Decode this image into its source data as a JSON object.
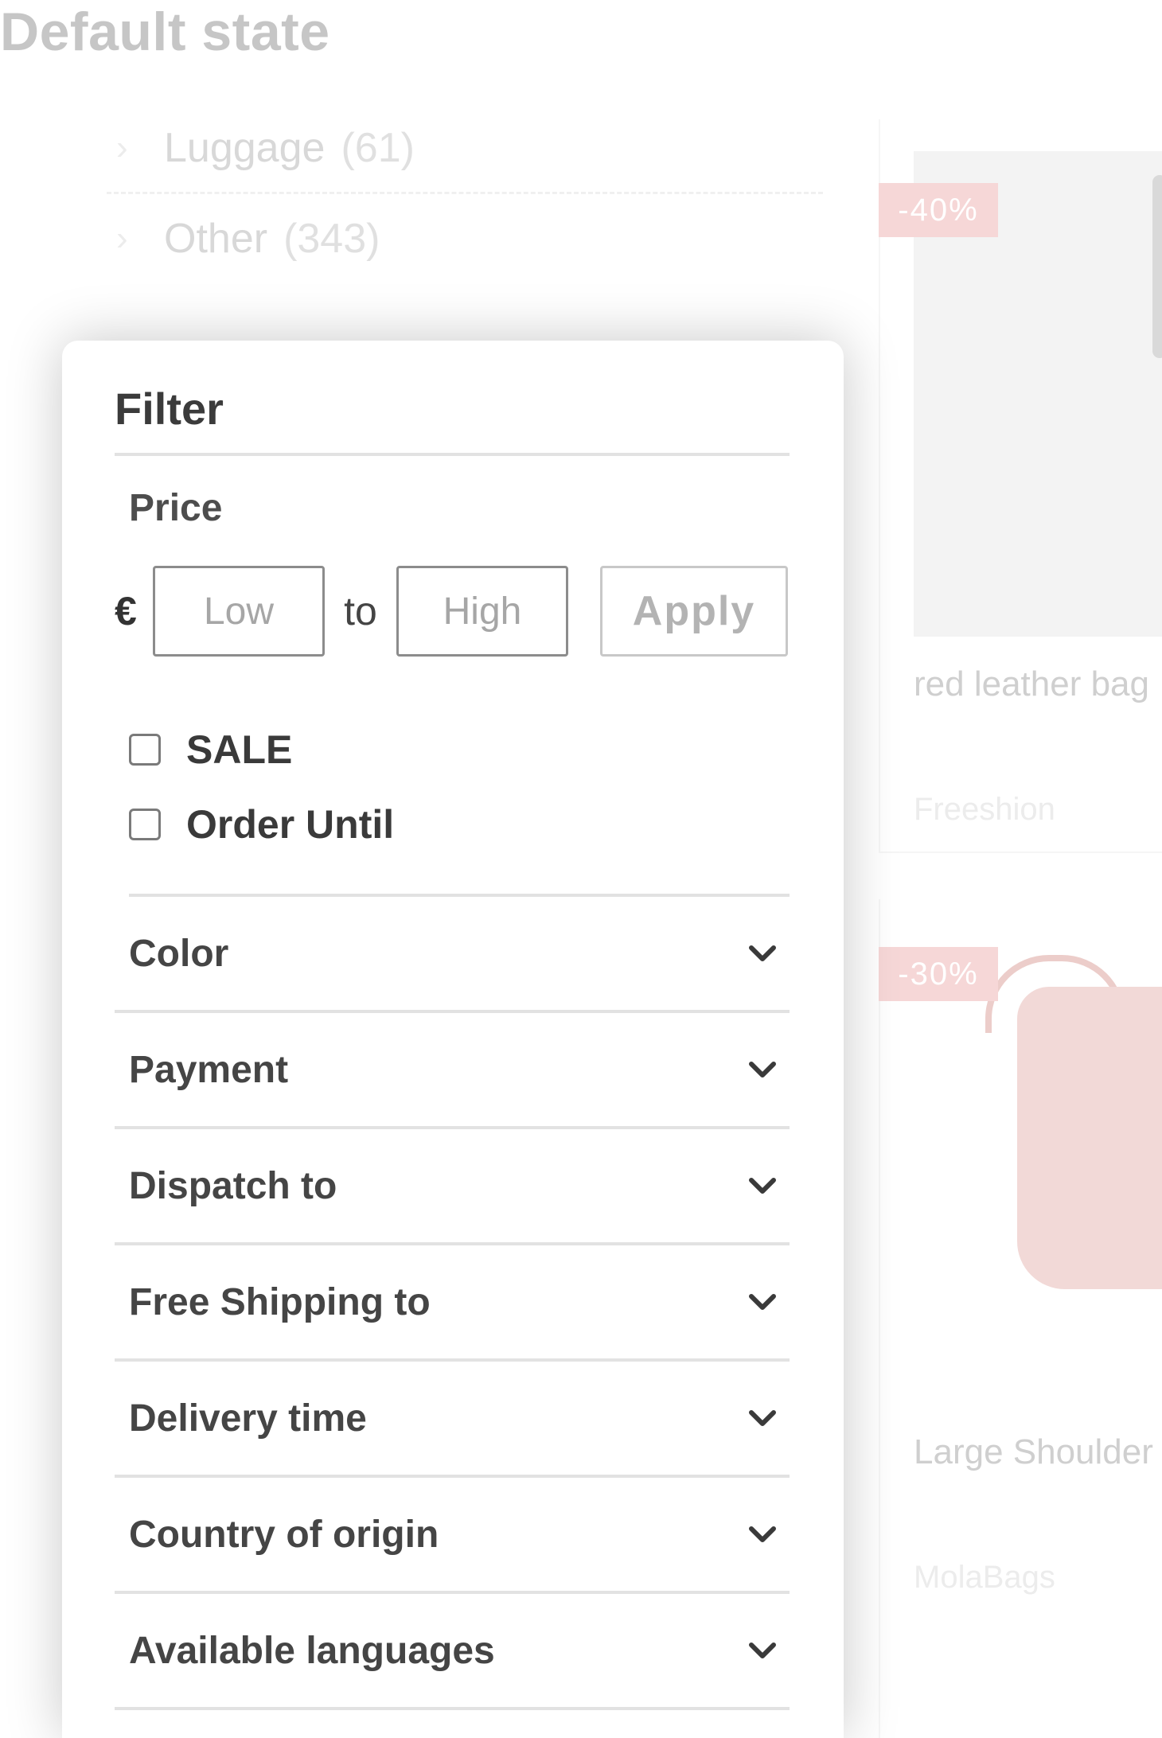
{
  "page_heading": "Default state",
  "categories": [
    {
      "label": "Luggage",
      "count": "(61)"
    },
    {
      "label": "Other",
      "count": "(343)"
    }
  ],
  "products": [
    {
      "badge": "-40%",
      "name": "red leather bag",
      "brand": "Freeshion"
    },
    {
      "badge": "-30%",
      "name": "Large Shoulder",
      "brand": "MolaBags"
    }
  ],
  "filter": {
    "title": "Filter",
    "price": {
      "label": "Price",
      "currency": "€",
      "low_placeholder": "Low",
      "to_label": "to",
      "high_placeholder": "High",
      "apply_label": "Apply"
    },
    "checkboxes": [
      {
        "label": "SALE",
        "checked": false
      },
      {
        "label": "Order Until",
        "checked": false
      }
    ],
    "facets": [
      "Color",
      "Payment",
      "Dispatch to",
      "Free Shipping to",
      "Delivery time",
      "Country of origin",
      "Available languages"
    ]
  }
}
